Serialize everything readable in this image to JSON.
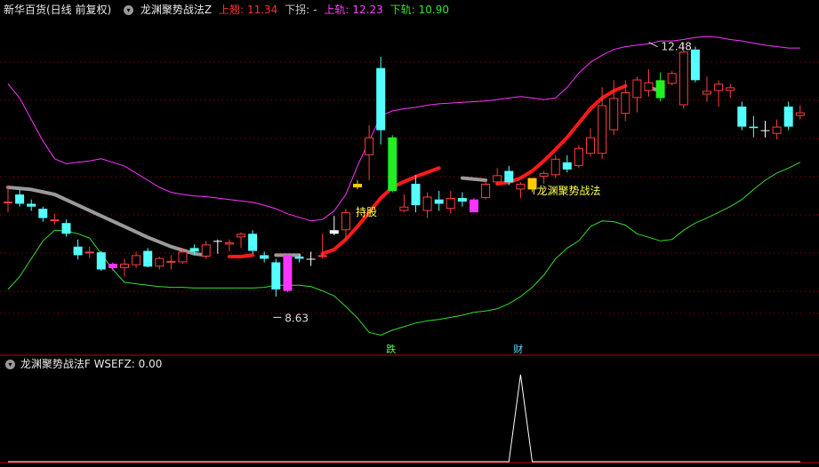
{
  "header": {
    "title": "新华百货(日线 前复权)",
    "indicator_name": "龙渊聚势战法Z",
    "upper_label": "上翘:",
    "upper_value": "11.34",
    "down_label": "下拐:",
    "down_value": "-",
    "rail_up_label": "上轨:",
    "rail_up_value": "12.23",
    "rail_down_label": "下轨:",
    "rail_down_value": "10.90"
  },
  "sub_header": {
    "indicator_name": "龙渊聚势战法F",
    "field_label": "WSEFZ:",
    "field_value": "0.00"
  },
  "annotations": {
    "high_label": "12.48",
    "low_label": "8.63",
    "hold_label": "持股",
    "signal_label": "龙渊聚势战法",
    "bottom_label_1": "跌",
    "bottom_label_2": "财"
  },
  "colors": {
    "background": "#000000",
    "up_candle": "#ff3c3c",
    "down_candle": "#54ffff",
    "upper_band": "#ff33ff",
    "lower_band": "#33dd33",
    "trend_red": "#ff1a1a",
    "trend_gray": "#9a9a9a",
    "special_yellow": "#ffcc00",
    "special_magenta": "#ff33ff",
    "special_green": "#22ee22",
    "grid": "#aa0000"
  },
  "chart_data": [
    {
      "type": "candlestick",
      "title": "新华百货(日线 前复权)",
      "ylim": [
        8.2,
        12.7
      ],
      "candles": [
        {
          "o": 10.25,
          "h": 10.48,
          "l": 10.1,
          "c": 10.25,
          "k": "u"
        },
        {
          "o": 10.35,
          "h": 10.42,
          "l": 10.18,
          "c": 10.22,
          "k": "d"
        },
        {
          "o": 10.22,
          "h": 10.28,
          "l": 10.12,
          "c": 10.18,
          "k": "d"
        },
        {
          "o": 10.15,
          "h": 10.18,
          "l": 9.97,
          "c": 10.02,
          "k": "d"
        },
        {
          "o": 10.0,
          "h": 10.08,
          "l": 9.93,
          "c": 10.0,
          "k": "u"
        },
        {
          "o": 9.95,
          "h": 10.0,
          "l": 9.76,
          "c": 9.8,
          "k": "d"
        },
        {
          "o": 9.62,
          "h": 9.72,
          "l": 9.44,
          "c": 9.5,
          "k": "d"
        },
        {
          "o": 9.55,
          "h": 9.62,
          "l": 9.46,
          "c": 9.55,
          "k": "u"
        },
        {
          "o": 9.54,
          "h": 9.56,
          "l": 9.28,
          "c": 9.3,
          "k": "d"
        },
        {
          "o": 9.32,
          "h": 9.4,
          "l": 9.28,
          "c": 9.38,
          "k": "m"
        },
        {
          "o": 9.32,
          "h": 9.45,
          "l": 9.2,
          "c": 9.38,
          "k": "u"
        },
        {
          "o": 9.36,
          "h": 9.55,
          "l": 9.32,
          "c": 9.5,
          "k": "u"
        },
        {
          "o": 9.56,
          "h": 9.6,
          "l": 9.33,
          "c": 9.34,
          "k": "d"
        },
        {
          "o": 9.34,
          "h": 9.48,
          "l": 9.3,
          "c": 9.46,
          "k": "u"
        },
        {
          "o": 9.42,
          "h": 9.5,
          "l": 9.3,
          "c": 9.42,
          "k": "u"
        },
        {
          "o": 9.4,
          "h": 9.6,
          "l": 9.38,
          "c": 9.55,
          "k": "u"
        },
        {
          "o": 9.55,
          "h": 9.65,
          "l": 9.5,
          "c": 9.6,
          "k": "d"
        },
        {
          "o": 9.48,
          "h": 9.7,
          "l": 9.45,
          "c": 9.65,
          "k": "u"
        },
        {
          "o": 9.7,
          "h": 9.72,
          "l": 9.52,
          "c": 9.7,
          "k": "w"
        },
        {
          "o": 9.68,
          "h": 9.72,
          "l": 9.55,
          "c": 9.65,
          "k": "u"
        },
        {
          "o": 9.75,
          "h": 9.82,
          "l": 9.6,
          "c": 9.8,
          "k": "u"
        },
        {
          "o": 9.8,
          "h": 9.85,
          "l": 9.52,
          "c": 9.56,
          "k": "d"
        },
        {
          "o": 9.5,
          "h": 9.55,
          "l": 9.4,
          "c": 9.45,
          "k": "d"
        },
        {
          "o": 9.4,
          "h": 9.45,
          "l": 8.92,
          "c": 9.02,
          "k": "d"
        },
        {
          "o": 9.0,
          "h": 9.52,
          "l": 8.98,
          "c": 9.5,
          "k": "m"
        },
        {
          "o": 9.48,
          "h": 9.52,
          "l": 9.4,
          "c": 9.45,
          "k": "d"
        },
        {
          "o": 9.45,
          "h": 9.55,
          "l": 9.35,
          "c": 9.45,
          "k": "w"
        },
        {
          "o": 9.5,
          "h": 9.8,
          "l": 9.45,
          "c": 9.5,
          "k": "u"
        },
        {
          "o": 9.8,
          "h": 10.05,
          "l": 9.78,
          "c": 9.85,
          "k": "w"
        },
        {
          "o": 9.85,
          "h": 10.15,
          "l": 9.7,
          "c": 10.1,
          "k": "u"
        },
        {
          "o": 10.45,
          "h": 10.55,
          "l": 10.42,
          "c": 10.5,
          "k": "y"
        },
        {
          "o": 10.9,
          "h": 11.32,
          "l": 10.55,
          "c": 11.15,
          "k": "u"
        },
        {
          "o": 12.12,
          "h": 12.28,
          "l": 11.05,
          "c": 11.25,
          "k": "d"
        },
        {
          "o": 11.15,
          "h": 11.18,
          "l": 10.38,
          "c": 10.4,
          "k": "g"
        },
        {
          "o": 10.18,
          "h": 10.35,
          "l": 10.1,
          "c": 10.12,
          "k": "u"
        },
        {
          "o": 10.5,
          "h": 10.62,
          "l": 10.1,
          "c": 10.2,
          "k": "d"
        },
        {
          "o": 10.12,
          "h": 10.38,
          "l": 10.02,
          "c": 10.32,
          "k": "u"
        },
        {
          "o": 10.28,
          "h": 10.4,
          "l": 10.12,
          "c": 10.22,
          "k": "d"
        },
        {
          "o": 10.15,
          "h": 10.4,
          "l": 10.08,
          "c": 10.3,
          "k": "u"
        },
        {
          "o": 10.3,
          "h": 10.38,
          "l": 10.18,
          "c": 10.25,
          "k": "d"
        },
        {
          "o": 10.1,
          "h": 10.3,
          "l": 10.1,
          "c": 10.28,
          "k": "m"
        },
        {
          "o": 10.3,
          "h": 10.55,
          "l": 10.28,
          "c": 10.5,
          "k": "u"
        },
        {
          "o": 10.52,
          "h": 10.72,
          "l": 10.48,
          "c": 10.62,
          "k": "u"
        },
        {
          "o": 10.68,
          "h": 10.75,
          "l": 10.48,
          "c": 10.52,
          "k": "d"
        },
        {
          "o": 10.42,
          "h": 10.52,
          "l": 10.3,
          "c": 10.5,
          "k": "u"
        },
        {
          "o": 10.42,
          "h": 10.58,
          "l": 10.38,
          "c": 10.58,
          "k": "y"
        },
        {
          "o": 10.6,
          "h": 10.68,
          "l": 10.5,
          "c": 10.65,
          "k": "u"
        },
        {
          "o": 10.62,
          "h": 10.9,
          "l": 10.58,
          "c": 10.85,
          "k": "u"
        },
        {
          "o": 10.8,
          "h": 10.9,
          "l": 10.66,
          "c": 10.7,
          "k": "d"
        },
        {
          "o": 10.75,
          "h": 11.04,
          "l": 10.72,
          "c": 11.0,
          "k": "u"
        },
        {
          "o": 10.92,
          "h": 11.28,
          "l": 10.88,
          "c": 11.15,
          "k": "u"
        },
        {
          "o": 10.92,
          "h": 11.85,
          "l": 10.85,
          "c": 11.6,
          "k": "u"
        },
        {
          "o": 11.25,
          "h": 11.95,
          "l": 11.18,
          "c": 11.7,
          "k": "u"
        },
        {
          "o": 11.48,
          "h": 11.95,
          "l": 11.38,
          "c": 11.78,
          "k": "u"
        },
        {
          "o": 11.7,
          "h": 12.0,
          "l": 11.5,
          "c": 11.96,
          "k": "u"
        },
        {
          "o": 11.8,
          "h": 12.1,
          "l": 11.72,
          "c": 11.92,
          "k": "u"
        },
        {
          "o": 11.95,
          "h": 12.06,
          "l": 11.65,
          "c": 11.7,
          "k": "g"
        },
        {
          "o": 11.9,
          "h": 12.08,
          "l": 11.88,
          "c": 12.05,
          "k": "u"
        },
        {
          "o": 11.6,
          "h": 12.48,
          "l": 11.55,
          "c": 12.35,
          "k": "u"
        },
        {
          "o": 12.38,
          "h": 12.42,
          "l": 11.92,
          "c": 11.95,
          "k": "d"
        },
        {
          "o": 11.75,
          "h": 12.0,
          "l": 11.65,
          "c": 11.8,
          "k": "u"
        },
        {
          "o": 11.9,
          "h": 11.95,
          "l": 11.58,
          "c": 11.8,
          "k": "u"
        },
        {
          "o": 11.85,
          "h": 11.9,
          "l": 11.7,
          "c": 11.8,
          "k": "u"
        },
        {
          "o": 11.58,
          "h": 11.65,
          "l": 11.25,
          "c": 11.3,
          "k": "d"
        },
        {
          "o": 11.3,
          "h": 11.45,
          "l": 11.15,
          "c": 11.28,
          "k": "d"
        },
        {
          "o": 11.25,
          "h": 11.38,
          "l": 11.15,
          "c": 11.25,
          "k": "w"
        },
        {
          "o": 11.2,
          "h": 11.4,
          "l": 11.12,
          "c": 11.3,
          "k": "u"
        },
        {
          "o": 11.58,
          "h": 11.65,
          "l": 11.25,
          "c": 11.3,
          "k": "d"
        },
        {
          "o": 11.5,
          "h": 11.6,
          "l": 11.4,
          "c": 11.45,
          "k": "u"
        }
      ],
      "upper_band": [
        11.9,
        11.7,
        11.4,
        11.1,
        10.85,
        10.78,
        10.8,
        10.82,
        10.85,
        10.8,
        10.75,
        10.65,
        10.55,
        10.45,
        10.38,
        10.35,
        10.33,
        10.32,
        10.3,
        10.28,
        10.26,
        10.24,
        10.2,
        10.15,
        10.08,
        10.03,
        9.98,
        10.0,
        10.12,
        10.35,
        10.75,
        11.1,
        11.45,
        11.52,
        11.55,
        11.57,
        11.6,
        11.62,
        11.63,
        11.64,
        11.65,
        11.66,
        11.68,
        11.7,
        11.72,
        11.7,
        11.68,
        11.7,
        11.85,
        12.05,
        12.2,
        12.3,
        12.38,
        12.42,
        12.44,
        12.46,
        12.5,
        12.5,
        12.52,
        12.55,
        12.56,
        12.55,
        12.52,
        12.5,
        12.47,
        12.44,
        12.42,
        12.4,
        12.4
      ],
      "lower_band": [
        9.02,
        9.2,
        9.45,
        9.7,
        9.85,
        9.84,
        9.8,
        9.74,
        9.52,
        9.3,
        9.12,
        9.1,
        9.08,
        9.06,
        9.05,
        9.05,
        9.04,
        9.04,
        9.04,
        9.04,
        9.04,
        9.04,
        9.05,
        9.08,
        9.08,
        9.08,
        9.06,
        9.0,
        8.93,
        8.78,
        8.62,
        8.42,
        8.38,
        8.45,
        8.5,
        8.55,
        8.58,
        8.6,
        8.63,
        8.66,
        8.7,
        8.72,
        8.75,
        8.82,
        8.92,
        9.05,
        9.22,
        9.45,
        9.6,
        9.7,
        9.9,
        9.98,
        9.97,
        9.92,
        9.8,
        9.75,
        9.7,
        9.72,
        9.85,
        9.95,
        10.02,
        10.1,
        10.18,
        10.28,
        10.42,
        10.55,
        10.65,
        10.72,
        10.8
      ],
      "trend_line": [
        {
          "i": 0,
          "v": 10.45,
          "c": "gray"
        },
        {
          "i": 2,
          "v": 10.42,
          "c": "gray"
        },
        {
          "i": 4,
          "v": 10.35,
          "c": "gray"
        },
        {
          "i": 6,
          "v": 10.2,
          "c": "gray"
        },
        {
          "i": 8,
          "v": 10.05,
          "c": "gray"
        },
        {
          "i": 10,
          "v": 9.9,
          "c": "gray"
        },
        {
          "i": 12,
          "v": 9.75,
          "c": "gray"
        },
        {
          "i": 14,
          "v": 9.62,
          "c": "gray"
        },
        {
          "i": 16,
          "v": 9.52,
          "c": "gray"
        },
        {
          "i": 17,
          "v": 9.5,
          "c": "gray"
        },
        {
          "i": 19,
          "v": 9.48,
          "c": "red"
        },
        {
          "i": 20,
          "v": 9.48,
          "c": "red"
        },
        {
          "i": 21,
          "v": 9.5,
          "c": "red"
        },
        {
          "i": 23,
          "v": 9.5,
          "c": "gray"
        },
        {
          "i": 24,
          "v": 9.5,
          "c": "gray"
        },
        {
          "i": 25,
          "v": 9.5,
          "c": "gray"
        },
        {
          "i": 27,
          "v": 9.52,
          "c": "red"
        },
        {
          "i": 28,
          "v": 9.58,
          "c": "red"
        },
        {
          "i": 29,
          "v": 9.72,
          "c": "red"
        },
        {
          "i": 30,
          "v": 9.9,
          "c": "red"
        },
        {
          "i": 31,
          "v": 10.1,
          "c": "red"
        },
        {
          "i": 32,
          "v": 10.3,
          "c": "red"
        },
        {
          "i": 33,
          "v": 10.45,
          "c": "red"
        },
        {
          "i": 34,
          "v": 10.53,
          "c": "red"
        },
        {
          "i": 35,
          "v": 10.6,
          "c": "red"
        },
        {
          "i": 36,
          "v": 10.66,
          "c": "red"
        },
        {
          "i": 37,
          "v": 10.72,
          "c": "red"
        },
        {
          "i": 39,
          "v": 10.58,
          "c": "gray"
        },
        {
          "i": 41,
          "v": 10.55,
          "c": "gray"
        },
        {
          "i": 42,
          "v": 10.5,
          "c": "red"
        },
        {
          "i": 43,
          "v": 10.52,
          "c": "red"
        },
        {
          "i": 44,
          "v": 10.58,
          "c": "red"
        },
        {
          "i": 45,
          "v": 10.68,
          "c": "red"
        },
        {
          "i": 46,
          "v": 10.82,
          "c": "red"
        },
        {
          "i": 47,
          "v": 10.98,
          "c": "red"
        },
        {
          "i": 48,
          "v": 11.15,
          "c": "red"
        },
        {
          "i": 49,
          "v": 11.35,
          "c": "red"
        },
        {
          "i": 50,
          "v": 11.55,
          "c": "red"
        },
        {
          "i": 51,
          "v": 11.7,
          "c": "red"
        },
        {
          "i": 52,
          "v": 11.8,
          "c": "red"
        },
        {
          "i": 53,
          "v": 11.87,
          "c": "red"
        },
        {
          "i": 55,
          "v": 11.85,
          "c": "gray"
        },
        {
          "i": 56,
          "v": 11.8,
          "c": "gray"
        }
      ],
      "high_point": {
        "i": 55,
        "v": 12.48
      },
      "low_point": {
        "i": 23,
        "v": 8.63
      }
    },
    {
      "type": "line",
      "title": "龙渊聚势战法F",
      "series": [
        {
          "name": "WSEFZ",
          "values": [
            0,
            0,
            0,
            0,
            0,
            0,
            0,
            0,
            0,
            0,
            0,
            0,
            0,
            0,
            0,
            0,
            0,
            0,
            0,
            0,
            0,
            0,
            0,
            0,
            0,
            0,
            0,
            0,
            0,
            0,
            0,
            0,
            0,
            0,
            0,
            0,
            0,
            0,
            0,
            0,
            0,
            0,
            0,
            0,
            1,
            0,
            0,
            0,
            0,
            0,
            0,
            0,
            0,
            0,
            0,
            0,
            0,
            0,
            0,
            0,
            0,
            0,
            0,
            0,
            0,
            0,
            0,
            0,
            0
          ]
        }
      ],
      "ylim": [
        0,
        1
      ]
    }
  ]
}
